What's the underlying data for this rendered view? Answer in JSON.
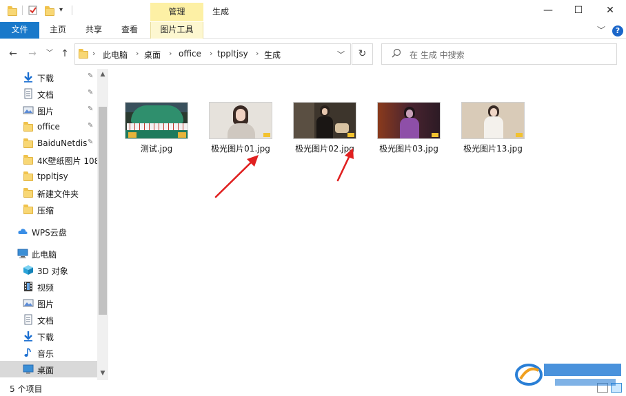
{
  "window": {
    "title": "生成",
    "contextual_group": "管理",
    "controls": {
      "minimize": "—",
      "maximize": "☐",
      "close": "✕"
    }
  },
  "quick_access": {
    "dropdown": "▾"
  },
  "ribbon": {
    "tabs": [
      {
        "label": "文件"
      },
      {
        "label": "主页"
      },
      {
        "label": "共享"
      },
      {
        "label": "查看"
      },
      {
        "label": "图片工具"
      }
    ],
    "collapse": "﹀",
    "help": "?"
  },
  "navigation": {
    "back": "←",
    "forward": "→",
    "recent": "﹀",
    "up": "↑"
  },
  "address": {
    "crumbs": [
      "此电脑",
      "桌面",
      "office",
      "tppltjsy",
      "生成"
    ],
    "separator": "›",
    "dropdown": "﹀",
    "refresh": "↻"
  },
  "search": {
    "placeholder": "在 生成 中搜索"
  },
  "sidebar": {
    "items": [
      {
        "label": "下载",
        "icon": "download-arrow-icon",
        "pinned": true
      },
      {
        "label": "文档",
        "icon": "document-icon",
        "pinned": true
      },
      {
        "label": "图片",
        "icon": "pictures-icon",
        "pinned": true
      },
      {
        "label": "office",
        "icon": "folder-icon",
        "pinned": true
      },
      {
        "label": "BaiduNetdis",
        "icon": "folder-icon",
        "pinned": true
      },
      {
        "label": "4K壁纸图片 108",
        "icon": "folder-icon",
        "pinned": false
      },
      {
        "label": "tppltjsy",
        "icon": "folder-icon",
        "pinned": false
      },
      {
        "label": "新建文件夹",
        "icon": "folder-icon",
        "pinned": false
      },
      {
        "label": "压缩",
        "icon": "folder-icon",
        "pinned": false
      },
      {
        "label": "WPS云盘",
        "icon": "cloud-icon",
        "pinned": false
      },
      {
        "label": "此电脑",
        "icon": "computer-icon",
        "pinned": false
      },
      {
        "label": "3D 对象",
        "icon": "cube-3d-icon",
        "pinned": false
      },
      {
        "label": "视频",
        "icon": "video-icon",
        "pinned": false
      },
      {
        "label": "图片",
        "icon": "pictures-icon",
        "pinned": false
      },
      {
        "label": "文档",
        "icon": "document-icon",
        "pinned": false
      },
      {
        "label": "下载",
        "icon": "download-arrow-icon",
        "pinned": false
      },
      {
        "label": "音乐",
        "icon": "music-note-icon",
        "pinned": false
      },
      {
        "label": "桌面",
        "icon": "desktop-icon",
        "pinned": false
      }
    ],
    "pin_glyph": "📌",
    "scroll_up": "▲",
    "scroll_down": "▼"
  },
  "files": [
    {
      "name": "测试.jpg",
      "thumb": "game-screenshot"
    },
    {
      "name": "极光图片01.jpg",
      "thumb": "portrait-light"
    },
    {
      "name": "极光图片02.jpg",
      "thumb": "portrait-dark"
    },
    {
      "name": "极光图片03.jpg",
      "thumb": "portrait-purple"
    },
    {
      "name": "极光图片13.jpg",
      "thumb": "portrait-beige"
    }
  ],
  "status": {
    "item_count": "5 个项目"
  },
  "colors": {
    "accent": "#1979ca",
    "manage_tab": "#fdf0a5",
    "annotation_arrow": "#e02020",
    "selection": "#cce8ff"
  }
}
